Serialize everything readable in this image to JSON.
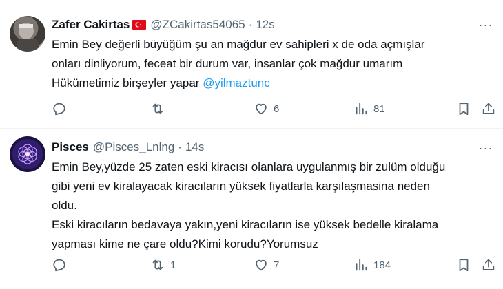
{
  "tweets": [
    {
      "name": "Zafer Cakirtas",
      "flag": "turkey-flag",
      "handle": "@ZCakirtas54065",
      "separator": "·",
      "time": "12s",
      "lines": [
        "Emin Bey değerli büyüğüm şu an mağdur ev sahipleri x de oda açmışlar",
        "onları dinliyorum, feceat bir durum var, insanlar çok mağdur umarım"
      ],
      "last_line_text": "Hükümetimiz birşeyler yapar ",
      "mention": "@yilmaztunc",
      "stats": {
        "replies": "",
        "retweets": "",
        "likes": "6",
        "views": "81"
      }
    },
    {
      "name": "Pisces",
      "handle": "@Pisces_Lnlng",
      "separator": "·",
      "time": "14s",
      "lines": [
        "Emin Bey,yüzde 25 zaten eski kiracısı olanlara uygulanmış bir zulüm olduğu",
        "gibi yeni ev kiralayacak kiracıların yüksek fiyatlarla karşılaşmasina neden",
        "oldu.",
        "Eski kiracıların bedavaya yakın,yeni kiracıların ise yüksek bedelle kiralama",
        "yapması kime ne çare oldu?Kimi korudu?Yorumsuz"
      ],
      "stats": {
        "replies": "",
        "retweets": "1",
        "likes": "7",
        "views": "184"
      }
    }
  ],
  "more_glyph": "···",
  "colors": {
    "text": "#0f1419",
    "secondary": "#536471",
    "link": "#1d9bf0",
    "divider": "#eff3f4"
  }
}
